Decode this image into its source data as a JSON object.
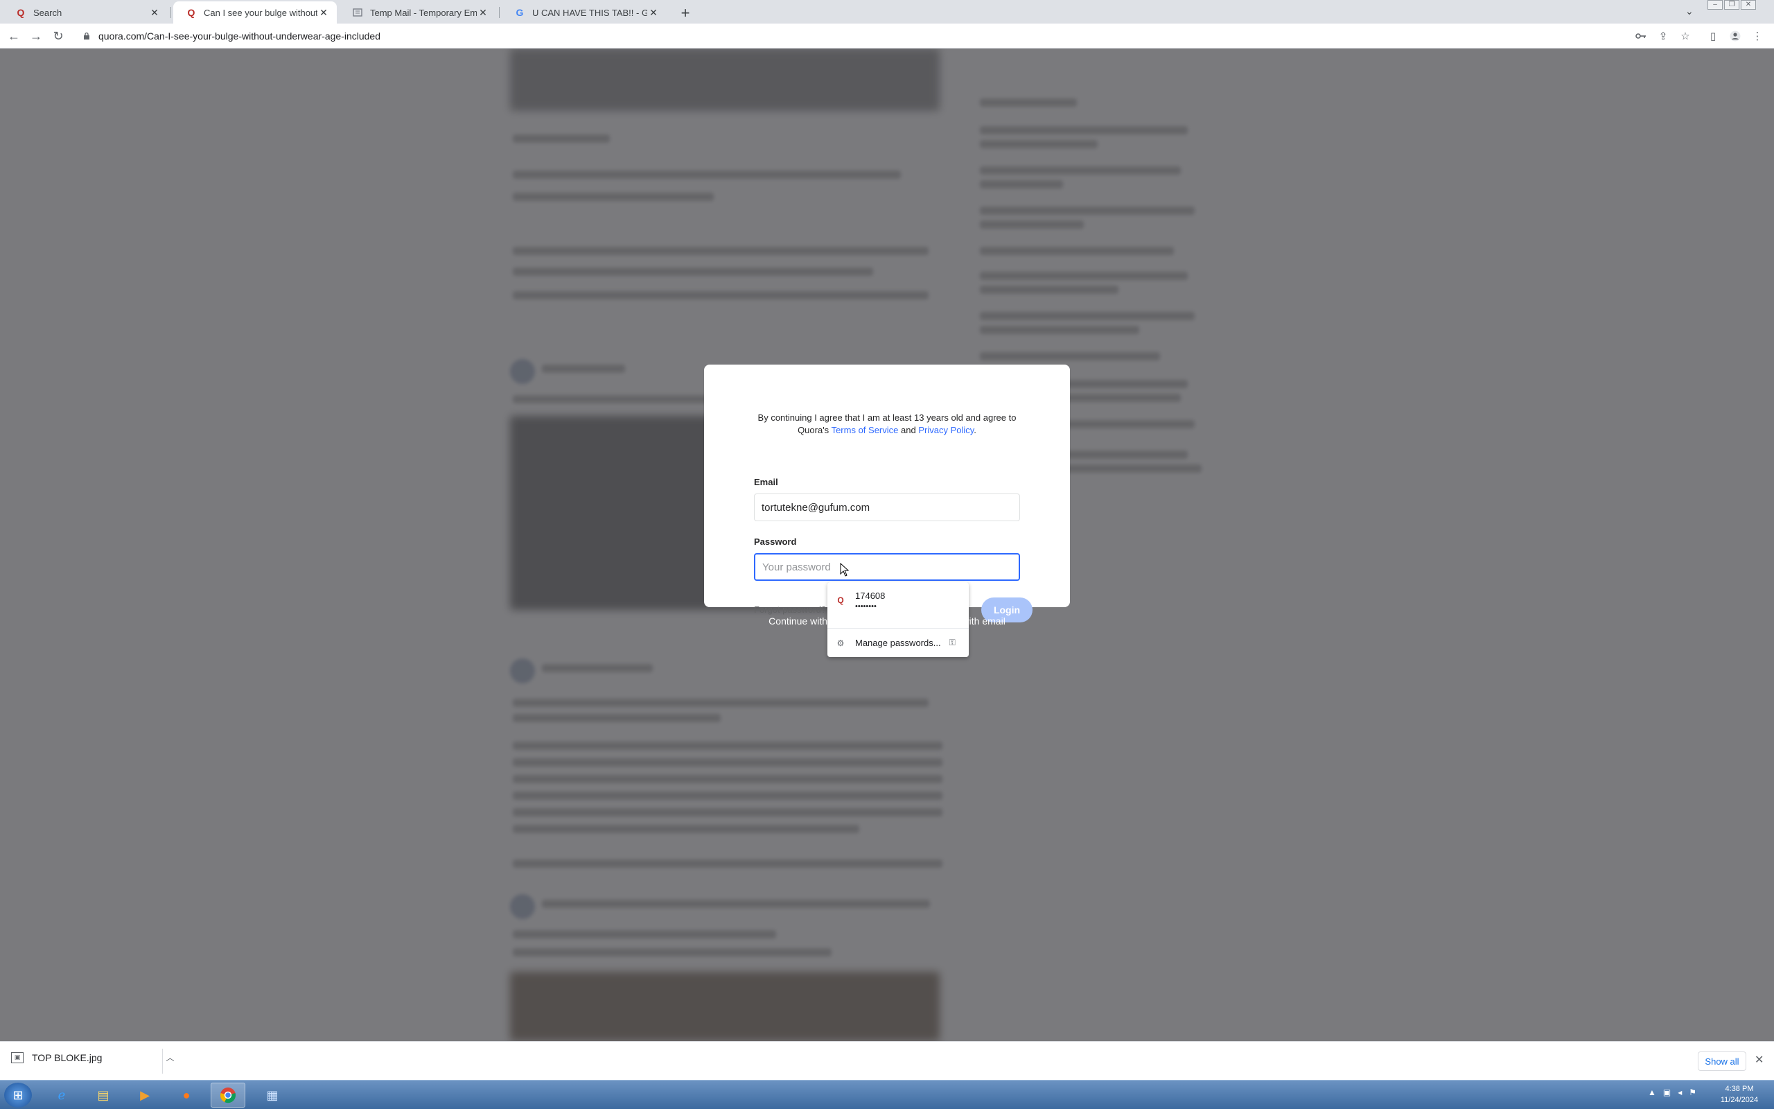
{
  "browser": {
    "tabs": [
      {
        "title": "Search",
        "favicon": "quora-icon",
        "active": false
      },
      {
        "title": "Can I see your bulge without un",
        "favicon": "quora-icon",
        "active": true
      },
      {
        "title": "Temp Mail - Temporary Email",
        "favicon": "tempmail-icon",
        "active": false
      },
      {
        "title": "U CAN HAVE THIS TAB!! - Google",
        "favicon": "google-icon",
        "active": false
      }
    ],
    "new_tab_symbol": "+",
    "url": "quora.com/Can-I-see-your-bulge-without-underwear-age-included"
  },
  "modal": {
    "consent_text_1": "By continuing I agree that I am at least 13 years old and agree to",
    "consent_text_2": "Quora's",
    "terms_link": "Terms of Service",
    "and_text": "and",
    "privacy_link": "Privacy Policy",
    "period": ".",
    "email_label": "Email",
    "email_value": "tortutekne@gufum.com",
    "password_label": "Password",
    "password_placeholder": "Your password",
    "forgot_link": "Forgot password?",
    "login_button": "Login"
  },
  "below_modal": {
    "continue_text": "Continue with Google or Facebook",
    "separator": "·",
    "signup_text": "Sign up with email"
  },
  "autofill": {
    "username": "174608",
    "password_mask": "••••••••",
    "manage_label": "Manage passwords..."
  },
  "download_bar": {
    "file_name": "TOP BLOKE.jpg",
    "show_all": "Show all"
  },
  "taskbar": {
    "time": "4:38 PM",
    "date": "11/24/2024"
  },
  "colors": {
    "quora_red": "#b92b27",
    "link_blue": "#2e69ff",
    "login_disabled": "#aac4fa"
  }
}
